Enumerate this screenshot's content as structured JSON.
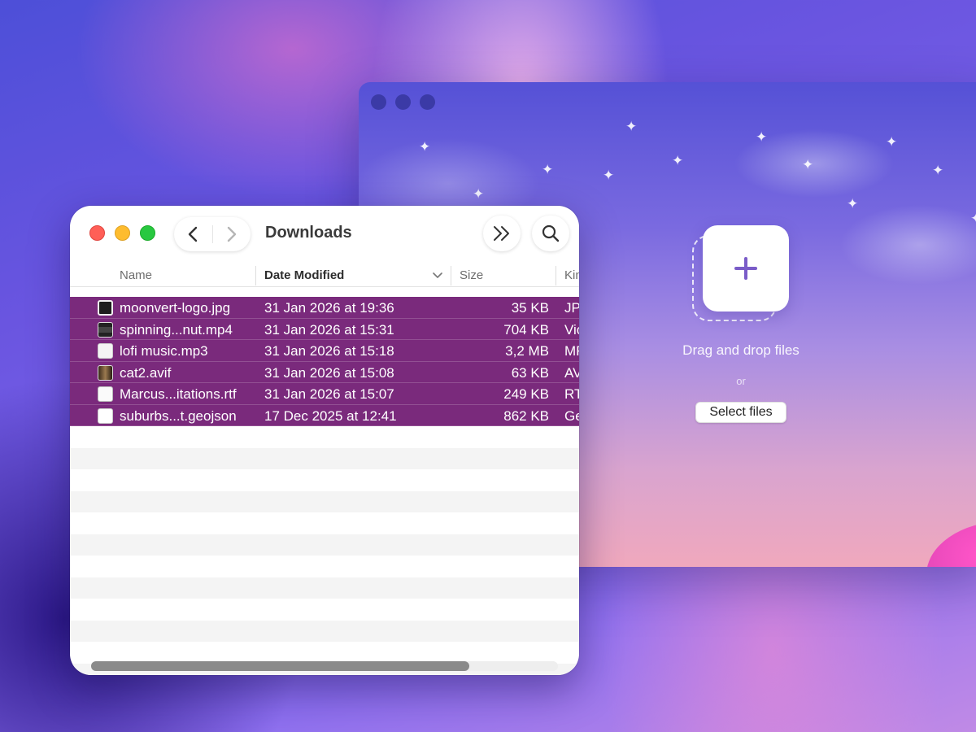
{
  "app": {
    "drop_text": "Drag and drop files",
    "or_text": "or",
    "select_button": "Select files",
    "plus_icon": "plus-icon"
  },
  "finder": {
    "title": "Downloads",
    "columns": {
      "name": "Name",
      "date": "Date Modified",
      "size": "Size",
      "kind": "Kin"
    },
    "files": [
      {
        "name": "moonvert-logo.jpg",
        "date": "31 Jan 2026 at 19:36",
        "size": "35 KB",
        "kind": "JP",
        "icon": "image-file-icon"
      },
      {
        "name": "spinning...nut.mp4",
        "date": "31 Jan 2026 at 15:31",
        "size": "704 KB",
        "kind": "Vic",
        "icon": "video-file-icon"
      },
      {
        "name": "lofi music.mp3",
        "date": "31 Jan 2026 at 15:18",
        "size": "3,2 MB",
        "kind": "MF",
        "icon": "audio-file-icon"
      },
      {
        "name": "cat2.avif",
        "date": "31 Jan 2026 at 15:08",
        "size": "63 KB",
        "kind": "AV",
        "icon": "image-file-icon"
      },
      {
        "name": "Marcus...itations.rtf",
        "date": "31 Jan 2026 at 15:07",
        "size": "249 KB",
        "kind": "RT",
        "icon": "rtf-file-icon"
      },
      {
        "name": "suburbs...t.geojson",
        "date": "17 Dec 2025 at 12:41",
        "size": "862 KB",
        "kind": "Ge",
        "icon": "document-file-icon"
      }
    ],
    "selection_color": "#7a2a7c"
  }
}
